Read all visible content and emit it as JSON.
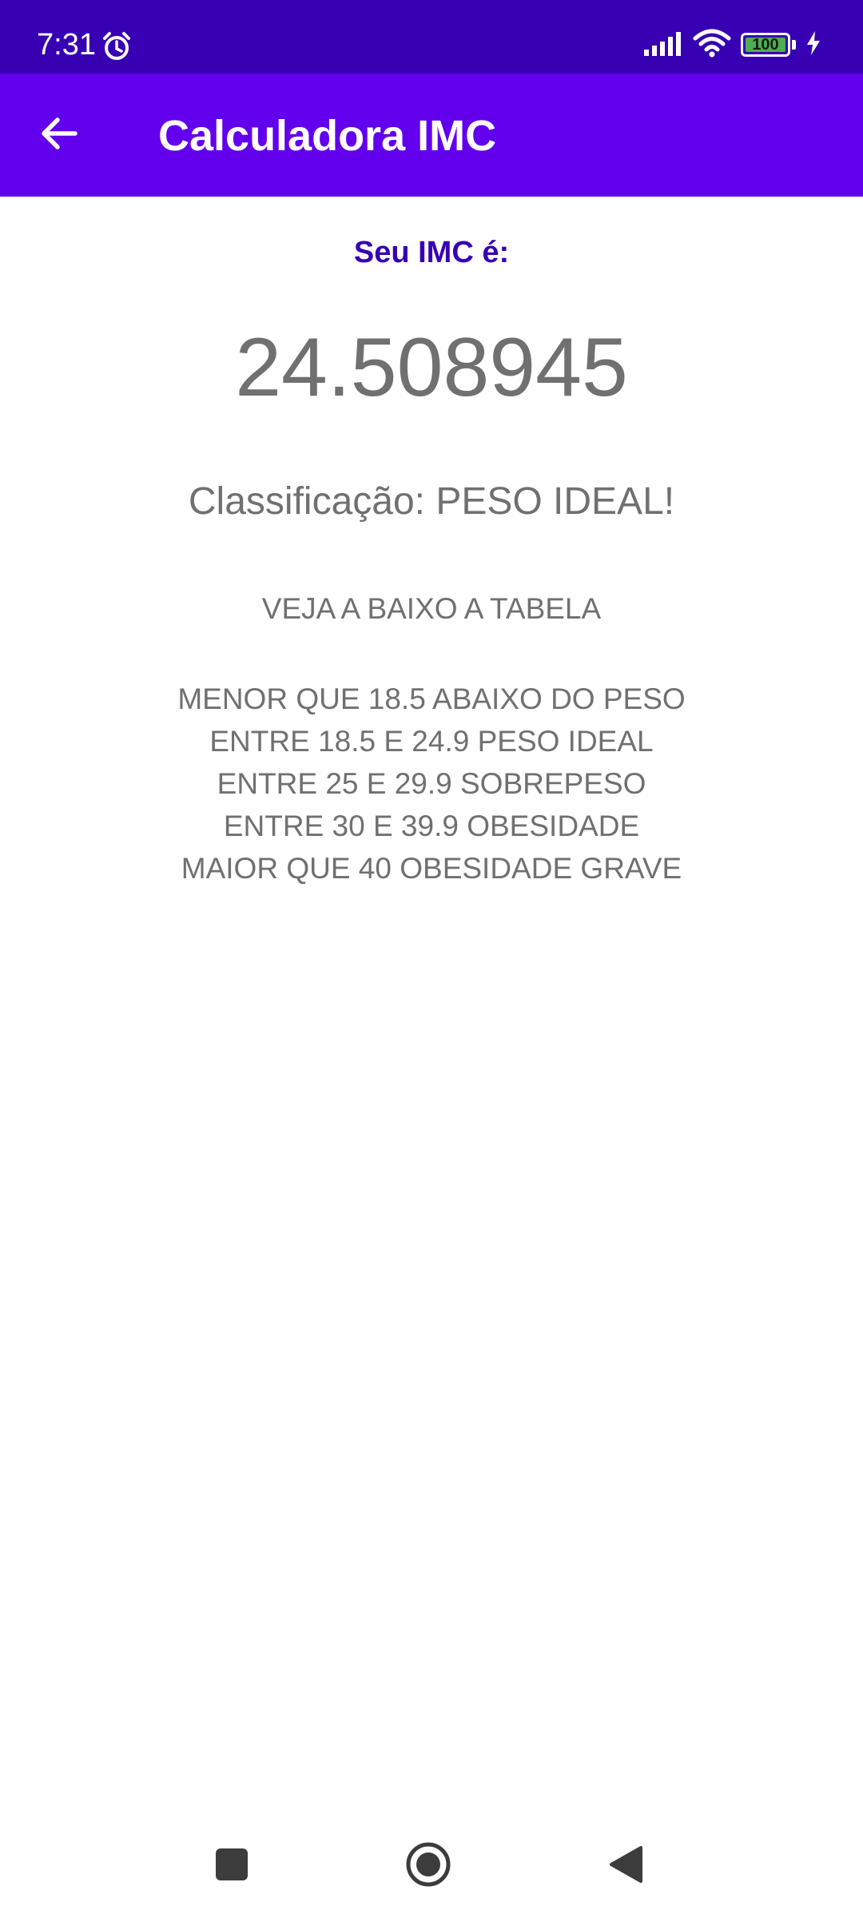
{
  "status_bar": {
    "time": "7:31",
    "battery_level": "100",
    "icons": [
      "alarm-icon",
      "signal-icon",
      "wifi-icon",
      "battery-icon",
      "charging-icon"
    ],
    "colors": {
      "background": "#3700b3",
      "battery_fill": "#4caf50"
    }
  },
  "app_bar": {
    "title": "Calculadora IMC",
    "back_icon": "arrow-left-icon",
    "colors": {
      "background": "#6200ee",
      "text": "#ffffff"
    }
  },
  "result": {
    "label": "Seu IMC é:",
    "value": "24.508945",
    "classification": "Classificação: PESO IDEAL!",
    "colors": {
      "label": "#3700b3",
      "text": "#707070"
    }
  },
  "table": {
    "header": "VEJA A BAIXO A TABELA",
    "rows": [
      "MENOR QUE 18.5 ABAIXO DO PESO",
      "ENTRE 18.5 E 24.9 PESO IDEAL",
      "ENTRE 25 E 29.9 SOBREPESO",
      "ENTRE 30 E 39.9 OBESIDADE",
      "MAIOR QUE 40 OBESIDADE GRAVE"
    ]
  },
  "nav_bar": {
    "icons": [
      "recent-apps-icon",
      "home-icon",
      "back-icon"
    ]
  }
}
